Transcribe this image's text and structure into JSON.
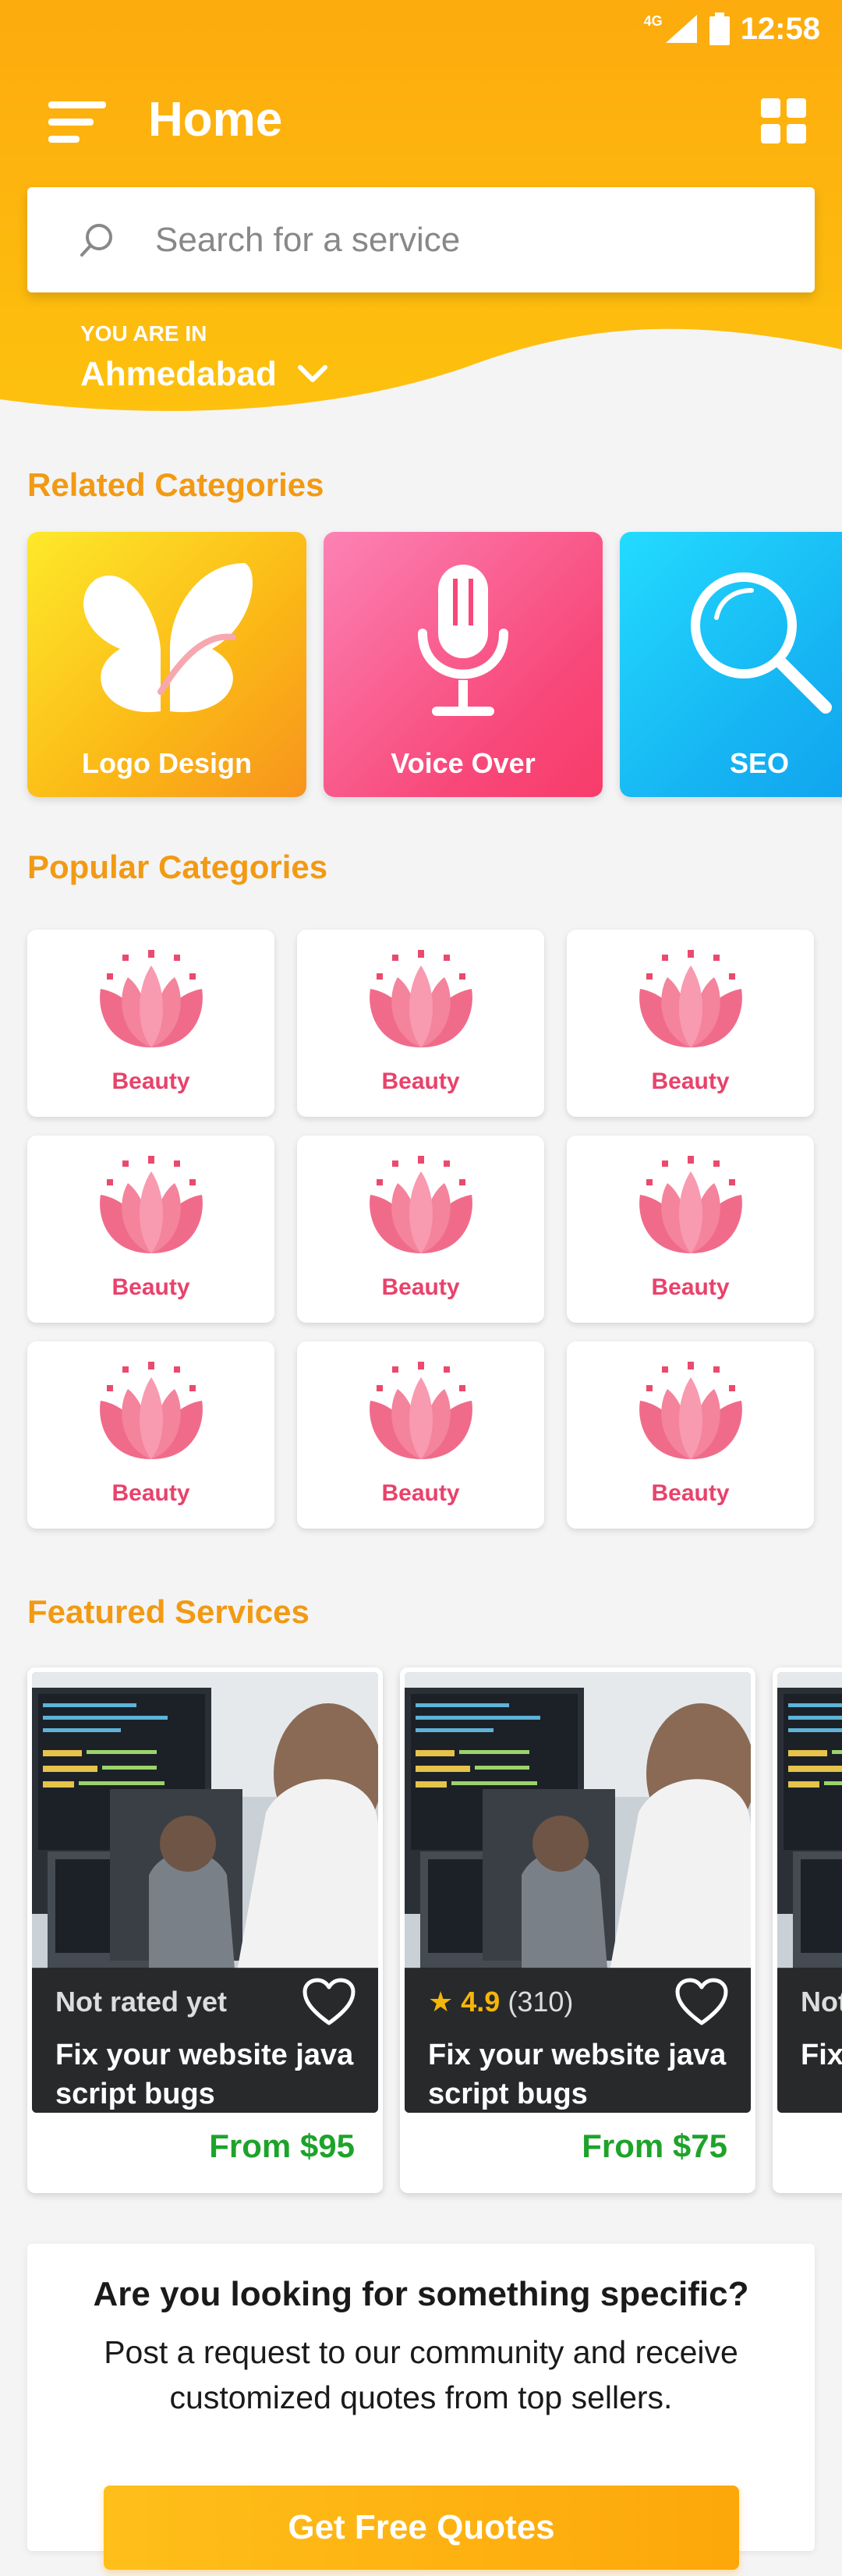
{
  "status_bar": {
    "network": "4G",
    "time": "12:58"
  },
  "header": {
    "title": "Home"
  },
  "search": {
    "placeholder": "Search for a service"
  },
  "location": {
    "label": "YOU ARE IN",
    "city": "Ahmedabad"
  },
  "related": {
    "title": "Related Categories",
    "items": [
      {
        "label": "Logo Design",
        "icon": "butterfly-icon"
      },
      {
        "label": "Voice Over",
        "icon": "microphone-icon"
      },
      {
        "label": "SEO",
        "icon": "magnifier-icon"
      }
    ]
  },
  "popular": {
    "title": "Popular Categories",
    "items": [
      {
        "label": "Beauty"
      },
      {
        "label": "Beauty"
      },
      {
        "label": "Beauty"
      },
      {
        "label": "Beauty"
      },
      {
        "label": "Beauty"
      },
      {
        "label": "Beauty"
      },
      {
        "label": "Beauty"
      },
      {
        "label": "Beauty"
      },
      {
        "label": "Beauty"
      }
    ]
  },
  "featured": {
    "title": "Featured Services",
    "items": [
      {
        "rating_text": "Not rated yet",
        "score": "",
        "count": "",
        "description": "Fix your website java script bugs",
        "price": "From $95"
      },
      {
        "rating_text": "",
        "score": "4.9",
        "count": "(310)",
        "description": "Fix your website java script bugs",
        "price": "From $75"
      },
      {
        "rating_text": "Not",
        "score": "",
        "count": "",
        "description": "Fix scr",
        "price": ""
      }
    ]
  },
  "request": {
    "question": "Are you looking for something specific?",
    "description": "Post a request to our community and receive customized quotes from top sellers.",
    "button": "Get Free Quotes"
  },
  "colors": {
    "accent": "#fdb513",
    "section_title": "#f29a13",
    "beauty": "#e8426b",
    "price": "#1ea32a"
  }
}
